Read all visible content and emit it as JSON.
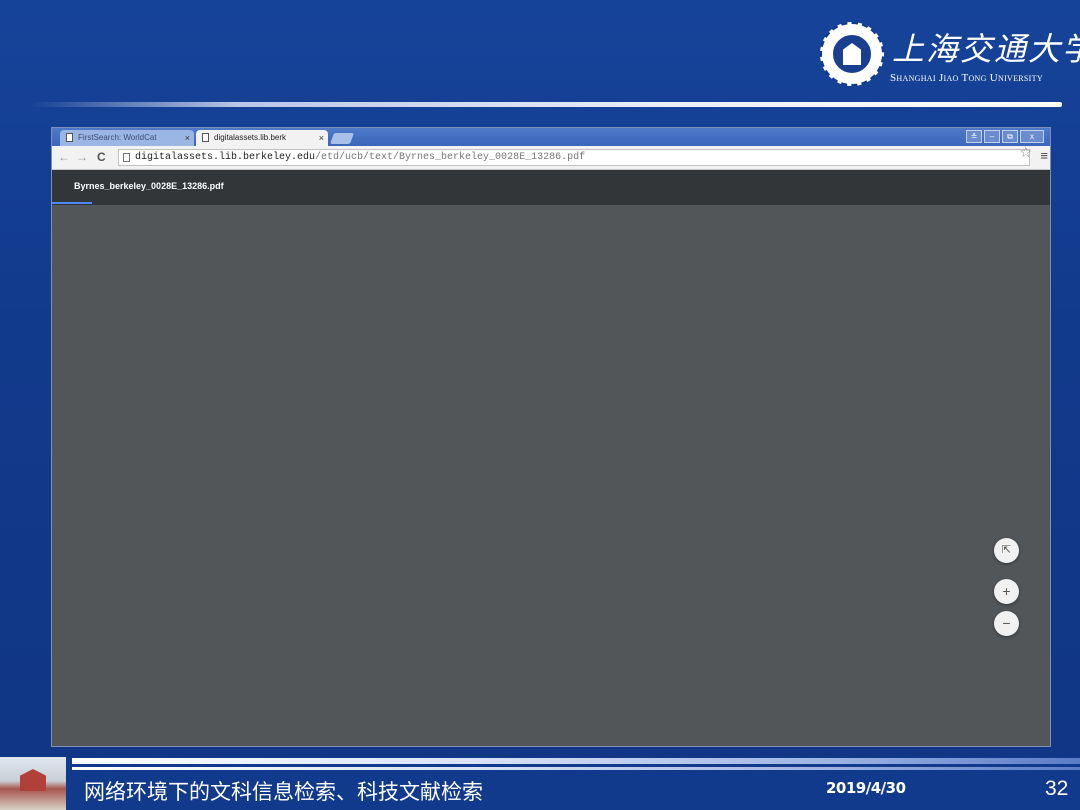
{
  "slide": {
    "logo_cn": "上海交通大学",
    "logo_en": "Shanghai Jiao Tong University",
    "footer_title": "网络环境下的文科信息检索、科技文献检索",
    "footer_date": "2019/4/30",
    "page_number": "32"
  },
  "browser": {
    "tabs": [
      {
        "label": "FirstSearch: WorldCat",
        "active": false
      },
      {
        "label": "digitalassets.lib.berk",
        "active": true
      }
    ],
    "tab_close": "×",
    "window_controls": {
      "profile": "≗",
      "minimize": "–",
      "restore": "⧉",
      "close": "x"
    },
    "nav": {
      "back": "←",
      "forward": "→",
      "reload": "C"
    },
    "url_host": "digitalassets.lib.berkeley.edu",
    "url_path": "/etd/ucb/text/Byrnes_berkeley_0028E_13286.pdf",
    "star": "☆",
    "menu": "≡"
  },
  "pdf_viewer": {
    "filename": "Byrnes_berkeley_0028E_13286.pdf",
    "fit_glyph": "⇱",
    "zoom_in_glyph": "+",
    "zoom_out_glyph": "−"
  },
  "colors": {
    "slide_blue": "#123a8c",
    "viewer_grey": "#525659",
    "pdf_toolbar": "#323639",
    "accent": "#4c8bf5"
  }
}
